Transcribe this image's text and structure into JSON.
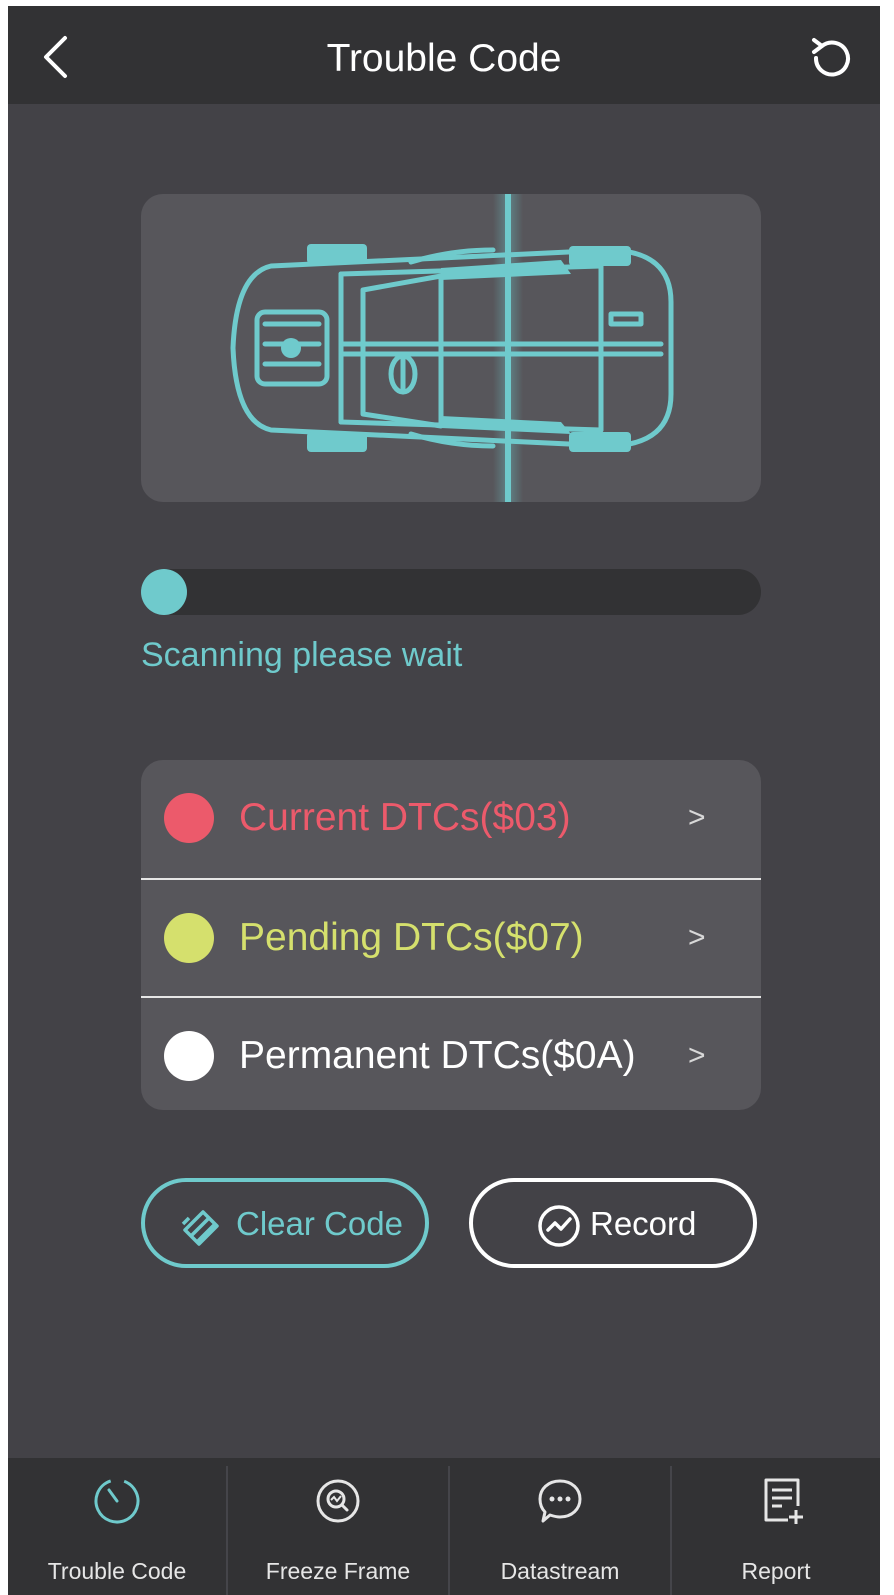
{
  "header": {
    "title": "Trouble Code",
    "back_icon": "chevron-left-icon",
    "refresh_icon": "refresh-icon"
  },
  "scan": {
    "status": "Scanning please wait",
    "progress_percent": 0,
    "accent_color": "#6fcacc"
  },
  "dtc_list": [
    {
      "label": "Current DTCs($03)",
      "color": "#ec5a6b",
      "chevron": ">"
    },
    {
      "label": "Pending DTCs($07)",
      "color": "#d5e06d",
      "chevron": ">"
    },
    {
      "label": "Permanent DTCs($0A)",
      "color": "#ffffff",
      "chevron": ">"
    }
  ],
  "actions": {
    "clear_label": "Clear Code",
    "clear_icon": "eraser-icon",
    "record_label": "Record",
    "record_icon": "pulse-circle-icon"
  },
  "bottom_nav": [
    {
      "label": "Trouble Code",
      "icon": "gauge-icon",
      "active": true
    },
    {
      "label": "Freeze Frame",
      "icon": "magnifier-icon",
      "active": false
    },
    {
      "label": "Datastream",
      "icon": "chat-bubble-icon",
      "active": false
    },
    {
      "label": "Report",
      "icon": "report-add-icon",
      "active": false
    }
  ]
}
